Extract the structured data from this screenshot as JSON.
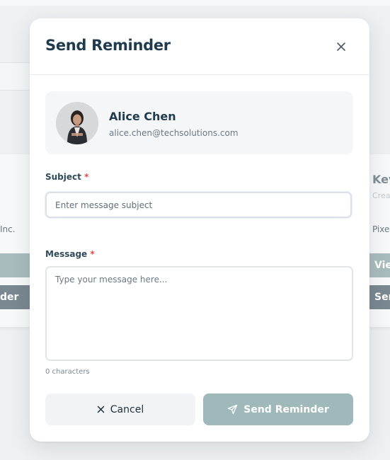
{
  "background": {
    "left_card": {
      "company_fragment": "Inc.",
      "button_top": "",
      "button_bottom": "der"
    },
    "right_card": {
      "name_fragment": "Kev",
      "role_fragment": "Crea",
      "company_fragment": "Pixel",
      "button_top": "View",
      "button_bottom": "Sen"
    }
  },
  "modal": {
    "title": "Send Reminder",
    "close_icon": "close-icon",
    "recipient": {
      "name": "Alice Chen",
      "email": "alice.chen@techsolutions.com"
    },
    "subject": {
      "label": "Subject",
      "required_mark": "*",
      "placeholder": "Enter message subject",
      "value": ""
    },
    "message": {
      "label": "Message",
      "required_mark": "*",
      "placeholder": "Type your message here...",
      "value": ""
    },
    "char_count": "0 characters",
    "actions": {
      "cancel_label": "Cancel",
      "cancel_icon": "x-icon",
      "send_label": "Send Reminder",
      "send_icon": "send-icon"
    }
  },
  "colors": {
    "title": "#1f3b4d",
    "required": "#e5484d",
    "send_button": "#9fb8b9",
    "cancel_button": "#f2f3f5"
  }
}
